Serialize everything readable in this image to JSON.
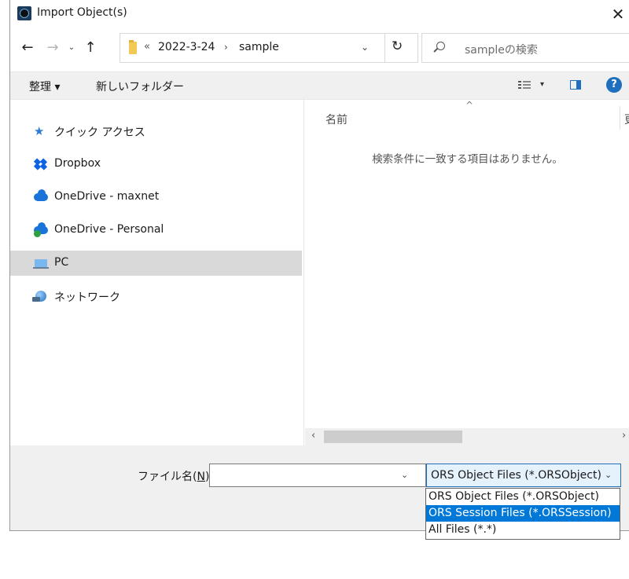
{
  "window": {
    "title": "Import Object(s)",
    "close_icon": "close-icon",
    "app_icon": "ors-app-icon"
  },
  "nav": {
    "back_icon": "arrow-left-icon",
    "forward_icon": "arrow-right-icon",
    "recent_icon": "chevron-down-icon",
    "up_icon": "arrow-up-icon",
    "back": "←",
    "forward": "→",
    "recent": "⌄",
    "up": "↑"
  },
  "address": {
    "more": "«",
    "crumbs": [
      "2022-3-24",
      "sample"
    ],
    "separator": "›",
    "dropdown": "⌄",
    "refresh": "↻"
  },
  "search": {
    "placeholder": "sampleの検索"
  },
  "toolbar": {
    "organize_label": "整理 ▾",
    "new_folder_label": "新しいフォルダー",
    "view_dropdown": "▾",
    "help_label": "?"
  },
  "sidebar": {
    "items": [
      {
        "label": "クイック アクセス",
        "icon": "star-icon",
        "selected": false
      },
      {
        "label": "Dropbox",
        "icon": "dropbox-icon",
        "selected": false
      },
      {
        "label": "OneDrive - maxnet",
        "icon": "onedrive-icon",
        "selected": false
      },
      {
        "label": "OneDrive - Personal",
        "icon": "onedrive-personal-icon",
        "selected": false
      },
      {
        "label": "PC",
        "icon": "pc-icon",
        "selected": true
      },
      {
        "label": "ネットワーク",
        "icon": "network-icon",
        "selected": false
      }
    ]
  },
  "file_list": {
    "sort_indicator": "^",
    "column_name": "名前",
    "column_next_partial": "更",
    "empty_message": "検索条件に一致する項目はありません。",
    "scroll_left": "‹",
    "scroll_right": "›"
  },
  "footer": {
    "filename_label_prefix": "ファイル名(",
    "filename_label_key": "N",
    "filename_label_suffix": "):",
    "filename_value": "",
    "filename_dropdown": "⌄",
    "filetype_selected": "ORS Object Files (*.ORSObject)",
    "filetype_chevron": "⌄",
    "filetype_options": [
      {
        "label": "ORS Object Files (*.ORSObject)",
        "highlighted": false
      },
      {
        "label": "ORS Session Files (*.ORSSession)",
        "highlighted": true
      },
      {
        "label": "All Files (*.*)",
        "highlighted": false
      }
    ]
  },
  "colors": {
    "accent": "#0078d7",
    "selected_row": "#d9d9d9",
    "panel": "#f0f0f0"
  }
}
